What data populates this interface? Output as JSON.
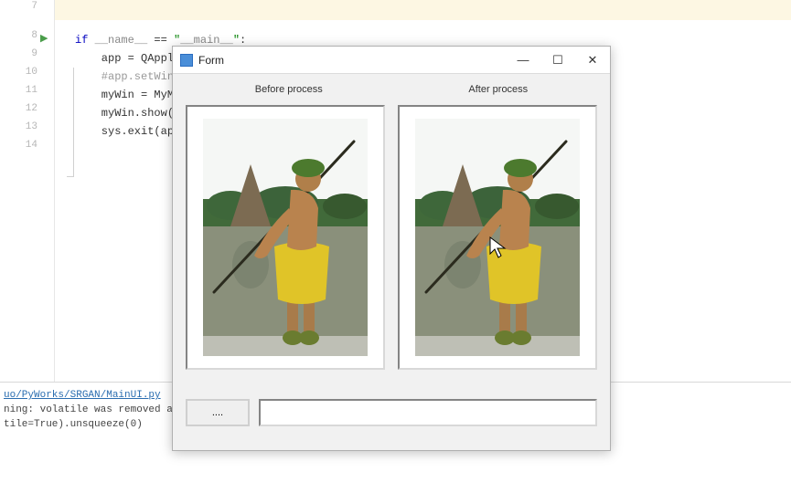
{
  "editor": {
    "line_numbers": [
      "7",
      "8",
      "9",
      "10",
      "11",
      "12",
      "13",
      "14"
    ],
    "lines": {
      "l7": "",
      "l8_if": "if",
      "l8_name": " __name__ ",
      "l8_eq": "== ",
      "l8_q1": "\"",
      "l8_main": "__main__",
      "l8_q2": "\"",
      "l8_colon": ":",
      "l9": "    app = QAppl",
      "l10": "    #app.setWin",
      "l11": "    myWin = MyM",
      "l12": "    myWin.show(",
      "l13": "    sys.exit(ap"
    }
  },
  "console": {
    "path": "uo/PyWorks/SRGAN/MainUI.py",
    "warn": "ning: volatile was removed a",
    "tail": "tile=True).unsqueeze(0)"
  },
  "dialog": {
    "title": "Form",
    "labels": {
      "before": "Before process",
      "after": "After process"
    },
    "button_label": "....",
    "input_value": ""
  }
}
